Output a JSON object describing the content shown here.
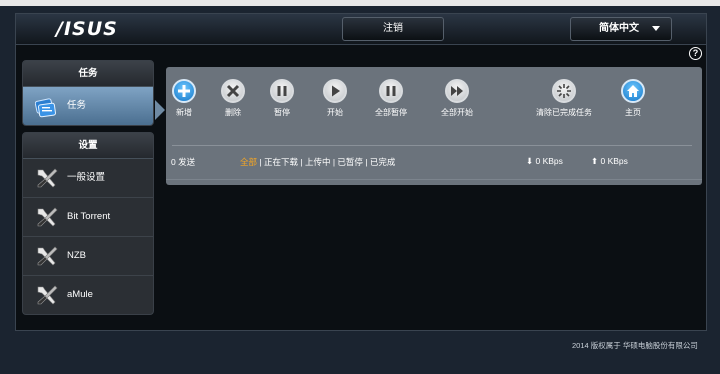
{
  "header": {
    "logo": "/ISUS",
    "logout_label": "注销",
    "language_label": "简体中文"
  },
  "help_label": "?",
  "sidebar": {
    "groups": [
      {
        "title": "任务",
        "items": [
          {
            "label": "任务",
            "icon": "tasks-icon",
            "active": true
          }
        ]
      },
      {
        "title": "设置",
        "items": [
          {
            "label": "一般设置",
            "icon": "tools-icon"
          },
          {
            "label": "Bit Torrent",
            "icon": "tools-icon"
          },
          {
            "label": "NZB",
            "icon": "tools-icon"
          },
          {
            "label": "aMule",
            "icon": "tools-icon"
          }
        ]
      }
    ]
  },
  "toolbar": {
    "add": "新增",
    "delete": "删除",
    "pause": "暂停",
    "start": "开始",
    "pause_all": "全部暂停",
    "start_all": "全部开始",
    "clear_completed": "清除已完成任务",
    "home": "主页"
  },
  "status": {
    "sending": "0 发送",
    "filters": [
      "全部",
      "正在下载",
      "上传中",
      "已暂停",
      "已完成"
    ],
    "active_filter": "全部",
    "download_speed": "0 KBps",
    "upload_speed": "0 KBps"
  },
  "footer": "2014 版权属于 华硕电脑股份有限公司",
  "colors": {
    "accent_orange": "#f5a623",
    "panel_gray": "#6b737c",
    "active_blue": "#5f86aa"
  }
}
